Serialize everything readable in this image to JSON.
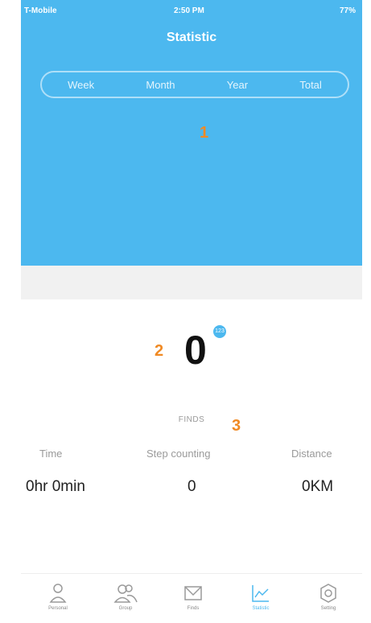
{
  "status_bar": {
    "carrier": "T-Mobile",
    "time": "2:50 PM",
    "battery": "77%"
  },
  "header": {
    "title": "Statistic"
  },
  "period_tabs": [
    {
      "label": "Week"
    },
    {
      "label": "Month"
    },
    {
      "label": "Year"
    },
    {
      "label": "Total"
    }
  ],
  "annotations": {
    "a1": "1",
    "a2": "2",
    "a3": "3"
  },
  "summary": {
    "value": "0",
    "badge": "123",
    "unit": "FINDS"
  },
  "metrics": {
    "time_label": "Time",
    "time_value": "0hr 0min",
    "steps_label": "Step counting",
    "steps_value": "0",
    "distance_label": "Distance",
    "distance_value": "0KM"
  },
  "tabbar": {
    "personal": "Personal",
    "group": "Group",
    "finds": "Finds",
    "statistic": "Statistic",
    "setting": "Setting"
  },
  "colors": {
    "accent": "#4cb8ef",
    "annotation": "#f08a24"
  }
}
